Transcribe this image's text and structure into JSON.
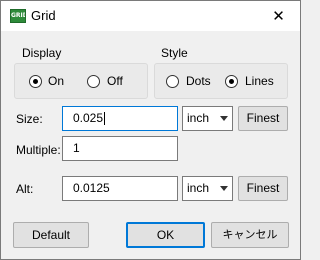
{
  "window": {
    "title": "Grid",
    "app_icon_text": "GRID",
    "close_glyph": "✕"
  },
  "display": {
    "label": "Display",
    "options": [
      {
        "label": "On",
        "checked": true
      },
      {
        "label": "Off",
        "checked": false
      }
    ]
  },
  "style": {
    "label": "Style",
    "options": [
      {
        "label": "Dots",
        "checked": false
      },
      {
        "label": "Lines",
        "checked": true
      }
    ]
  },
  "size": {
    "label": "Size:",
    "value": "0.025",
    "unit": "inch",
    "finest_label": "Finest"
  },
  "multiple": {
    "label": "Multiple:",
    "value": "1"
  },
  "alt": {
    "label": "Alt:",
    "value": "0.0125",
    "unit": "inch",
    "finest_label": "Finest"
  },
  "buttons": {
    "default_label": "Default",
    "ok_label": "OK",
    "cancel_label": "キャンセル"
  },
  "colors": {
    "accent": "#0078d7",
    "icon_green": "#2e8b3a"
  }
}
